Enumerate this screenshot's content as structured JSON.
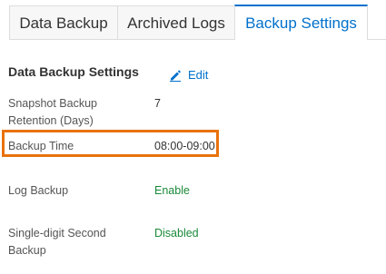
{
  "tabs": [
    {
      "label": "Data Backup",
      "active": false
    },
    {
      "label": "Archived Logs",
      "active": false
    },
    {
      "label": "Backup Settings",
      "active": true
    }
  ],
  "section": {
    "title": "Data Backup Settings",
    "edit_label": "Edit",
    "edit_icon": "pencil-icon"
  },
  "settings": {
    "retention": {
      "label": "Snapshot Backup Retention (Days)",
      "value": "7"
    },
    "backup_time": {
      "label": "Backup Time",
      "value": "08:00-09:00",
      "highlighted": true
    },
    "log_backup": {
      "label": "Log Backup",
      "value": "Enable"
    },
    "single_digit_second": {
      "label": "Single-digit Second Backup",
      "value": "Disabled"
    }
  },
  "colors": {
    "accent": "#0070cc",
    "enabled_green": "#1b8a3a",
    "highlight_orange": "#e8720c"
  }
}
